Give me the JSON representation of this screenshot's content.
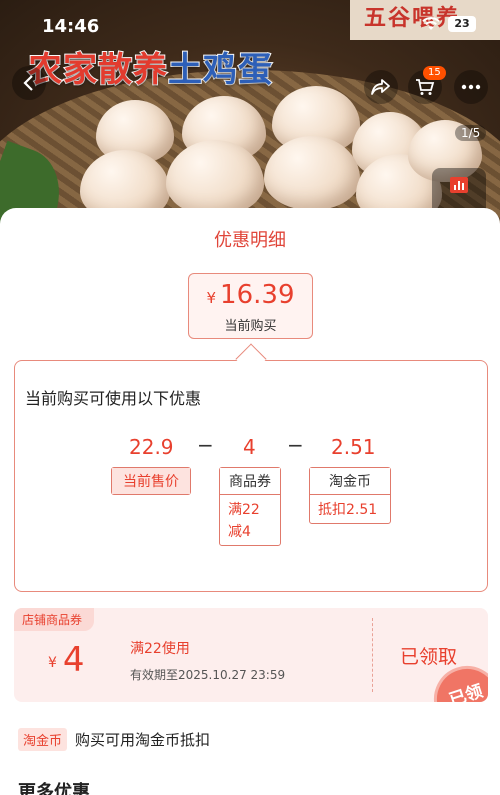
{
  "status_bar": {
    "time": "14:46",
    "battery": "23"
  },
  "hero": {
    "title_red": "农家散养",
    "title_blue": "土鸡蛋",
    "brand_tag": "五谷喂养",
    "cart_count": "15",
    "image_counter": "1/5"
  },
  "sheet": {
    "title": "优惠明细",
    "price": {
      "currency": "¥",
      "amount": "16.39",
      "label": "当前购买"
    },
    "calc": {
      "heading": "当前购买可使用以下优惠",
      "minus": "−",
      "items": [
        {
          "value": "22.9",
          "label": "当前售价",
          "detail": []
        },
        {
          "value": "4",
          "label": "商品券",
          "detail": [
            "满22",
            "减4"
          ]
        },
        {
          "value": "2.51",
          "label": "淘金币",
          "detail": [
            "抵扣2.51"
          ]
        }
      ]
    },
    "coupon": {
      "type": "店铺商品券",
      "currency": "¥",
      "amount": "4",
      "condition": "满22使用",
      "validity": "有效期至2025.10.27 23:59",
      "action": "已领取",
      "stamp": "已领"
    },
    "coin": {
      "badge": "淘金币",
      "text": "购买可用淘金币抵扣"
    },
    "more_title": "更多优惠"
  },
  "colors": {
    "accent": "#e8402e",
    "border": "#e88a7c",
    "tint": "#fdeeed"
  }
}
